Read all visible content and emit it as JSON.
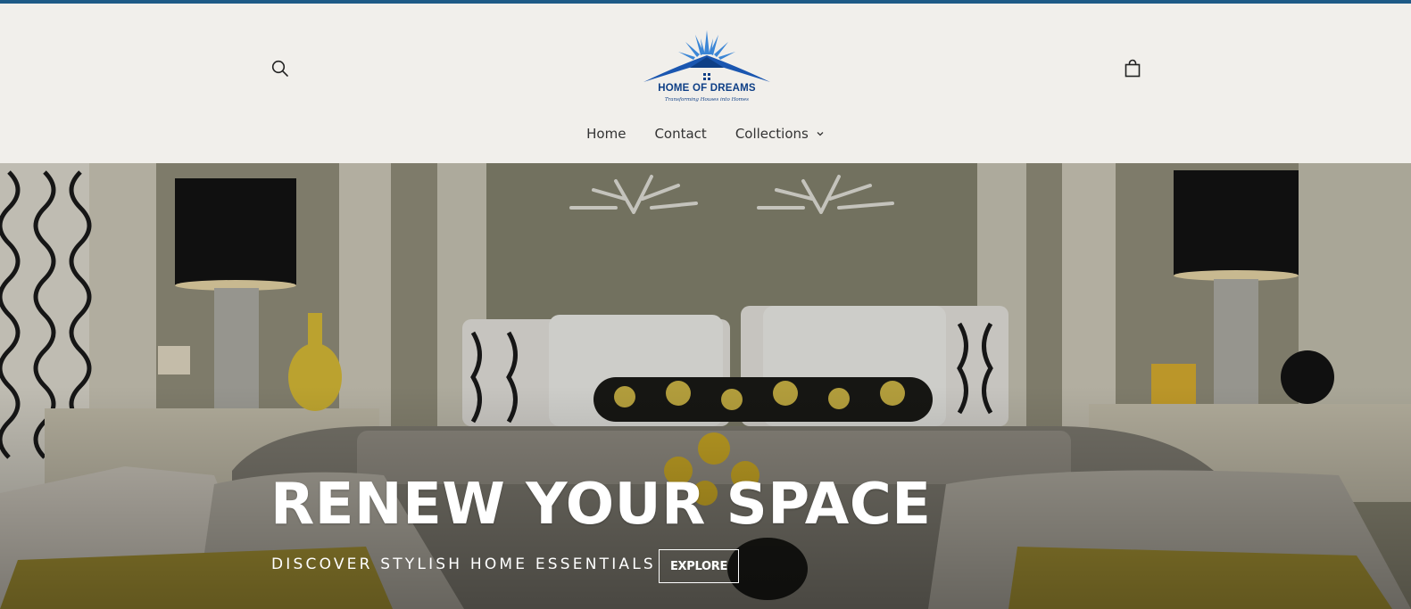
{
  "brand": {
    "name": "HOME OF DREAMS",
    "tagline": "Transforming Houses into Homes",
    "accent_color": "#1e5a86",
    "logo_blue": "#0e3f86"
  },
  "header": {
    "search_icon": "search-icon",
    "cart_icon": "shopping-bag-icon"
  },
  "nav": {
    "items": [
      {
        "label": "Home"
      },
      {
        "label": "Contact"
      },
      {
        "label": "Collections",
        "has_dropdown": true
      }
    ]
  },
  "hero": {
    "title": "RENEW YOUR SPACE",
    "subtitle": "DISCOVER STYLISH HOME ESSENTIALS",
    "button_label": "EXPLORE"
  }
}
